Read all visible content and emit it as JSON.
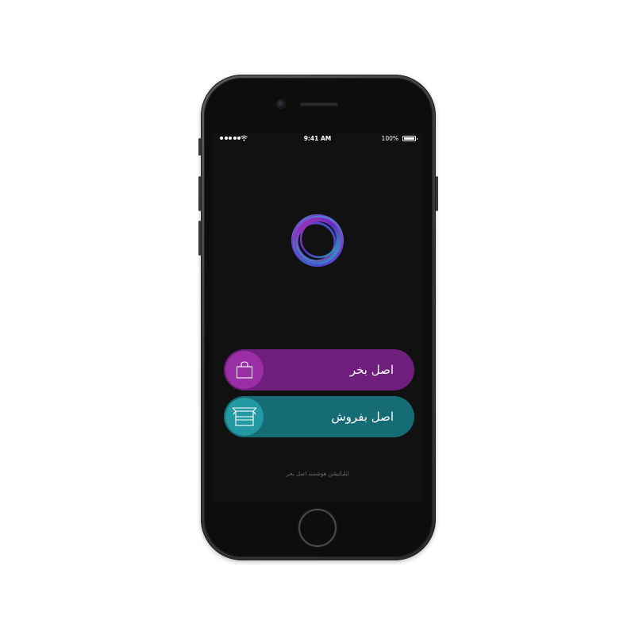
{
  "status_bar": {
    "time": "9:41 AM",
    "battery": "100%",
    "icons": [
      "signal-dots-icon",
      "wifi-icon",
      "battery-icon"
    ]
  },
  "logo": {
    "icon": "ring-logo-icon",
    "colors": [
      "#7b2fd6",
      "#c23ad0",
      "#2a64f2",
      "#21c7d9"
    ]
  },
  "buttons": {
    "buy": {
      "label": "اصل بخر",
      "icon": "shopping-bag-icon",
      "color": "#6e1e7c",
      "icon_bg": "#9a2ea5"
    },
    "sell": {
      "label": "اصل بفروش",
      "icon": "box-icon",
      "color": "#156c75",
      "icon_bg": "#2399a3"
    }
  },
  "footer": {
    "text": "اپلیکیشن هوشمند اصل بخر"
  }
}
